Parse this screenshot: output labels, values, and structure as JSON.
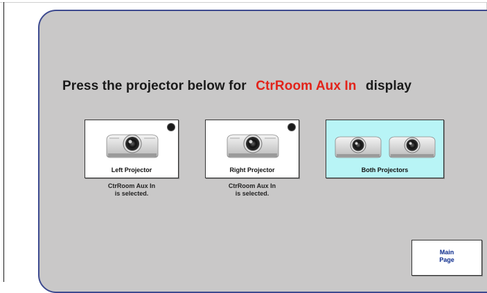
{
  "header": {
    "prompt_prefix": "Press the projector below for",
    "source_name": "CtrRoom Aux In",
    "prompt_suffix": "display"
  },
  "buttons": {
    "left": {
      "label": "Left Projector",
      "status_line1": "CtrRoom Aux In",
      "status_line2": "is selected."
    },
    "right": {
      "label": "Right Projector",
      "status_line1": "CtrRoom Aux In",
      "status_line2": "is selected."
    },
    "both": {
      "label": "Both Projectors"
    }
  },
  "nav": {
    "main_page_line1": "Main",
    "main_page_line2": "Page"
  },
  "colors": {
    "panel_bg": "#c9c8c8",
    "panel_border": "#3d4a8f",
    "source_highlight": "#e2231a",
    "both_button_bg": "#b8f4f6",
    "main_page_text": "#0a2a8c"
  },
  "icons": {
    "projector": "projector-icon",
    "indicator": "status-dot-icon"
  }
}
